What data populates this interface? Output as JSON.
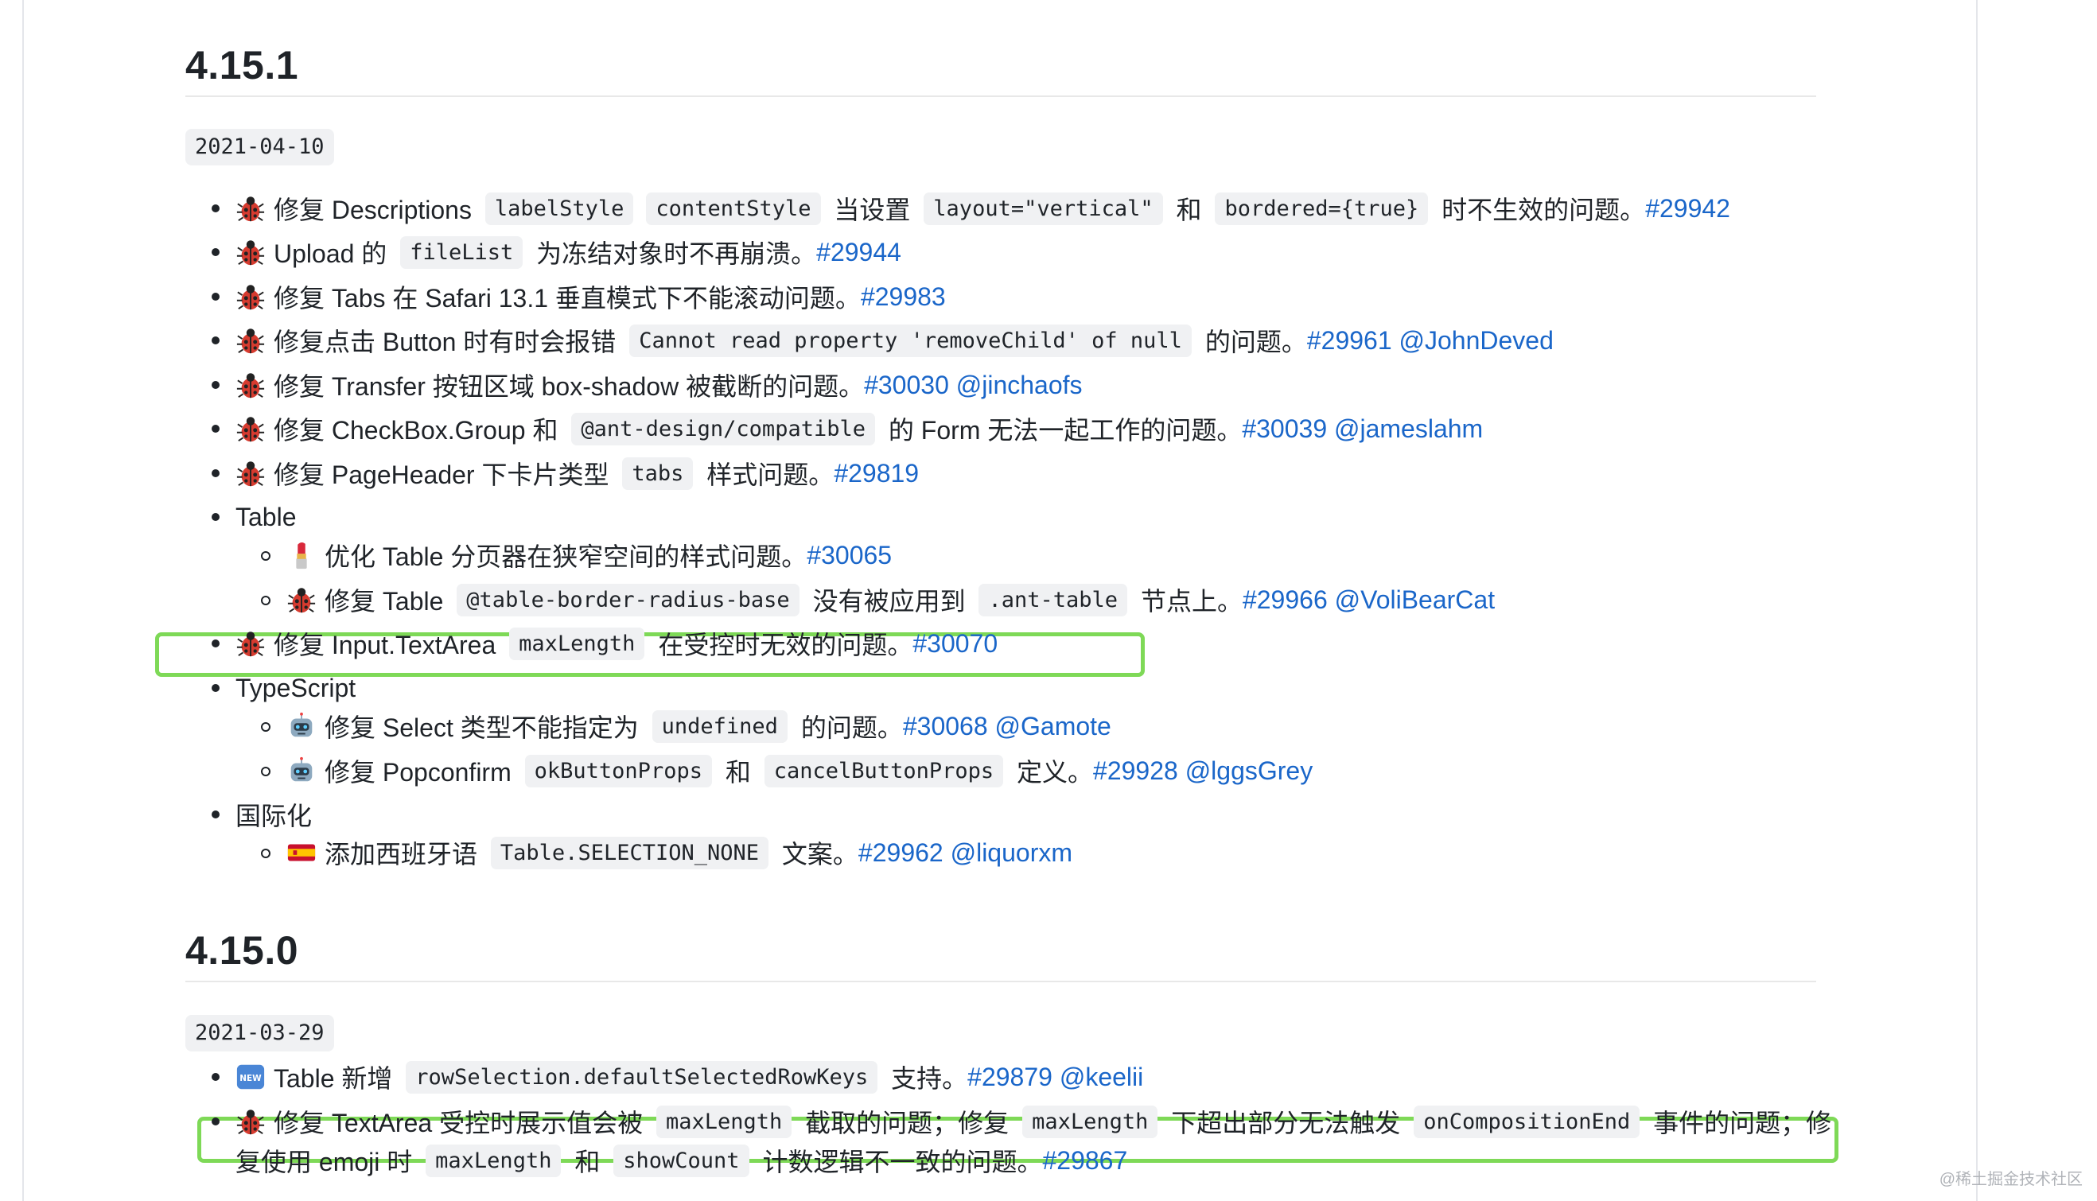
{
  "sections": [
    {
      "version": "4.15.1",
      "date": "2021-04-10",
      "items": [
        {
          "emoji": "bug-icon",
          "parts": [
            {
              "t": "text",
              "v": "修复 Descriptions "
            },
            {
              "t": "code",
              "v": "labelStyle"
            },
            {
              "t": "code",
              "v": "contentStyle"
            },
            {
              "t": "text",
              "v": " 当设置 "
            },
            {
              "t": "code",
              "v": "layout=\"vertical\""
            },
            {
              "t": "text",
              "v": " 和 "
            },
            {
              "t": "code",
              "v": "bordered={true}"
            },
            {
              "t": "text",
              "v": " 时不生效的问题。"
            },
            {
              "t": "link",
              "v": "#29942"
            }
          ]
        },
        {
          "emoji": "bug-icon",
          "parts": [
            {
              "t": "text",
              "v": "Upload 的 "
            },
            {
              "t": "code",
              "v": "fileList"
            },
            {
              "t": "text",
              "v": " 为冻结对象时不再崩溃。"
            },
            {
              "t": "link",
              "v": "#29944"
            }
          ]
        },
        {
          "emoji": "bug-icon",
          "parts": [
            {
              "t": "text",
              "v": "修复 Tabs 在 Safari 13.1 垂直模式下不能滚动问题。"
            },
            {
              "t": "link",
              "v": "#29983"
            }
          ]
        },
        {
          "emoji": "bug-icon",
          "parts": [
            {
              "t": "text",
              "v": "修复点击 Button 时有时会报错 "
            },
            {
              "t": "code",
              "v": "Cannot read property 'removeChild' of null"
            },
            {
              "t": "text",
              "v": " 的问题。"
            },
            {
              "t": "link",
              "v": "#29961"
            },
            {
              "t": "text",
              "v": " "
            },
            {
              "t": "link",
              "v": "@JohnDeved"
            }
          ]
        },
        {
          "emoji": "bug-icon",
          "parts": [
            {
              "t": "text",
              "v": "修复 Transfer 按钮区域 box-shadow 被截断的问题。"
            },
            {
              "t": "link",
              "v": "#30030"
            },
            {
              "t": "text",
              "v": " "
            },
            {
              "t": "link",
              "v": "@jinchaofs"
            }
          ]
        },
        {
          "emoji": "bug-icon",
          "parts": [
            {
              "t": "text",
              "v": "修复 CheckBox.Group 和 "
            },
            {
              "t": "code",
              "v": "@ant-design/compatible"
            },
            {
              "t": "text",
              "v": " 的 Form 无法一起工作的问题。"
            },
            {
              "t": "link",
              "v": "#30039"
            },
            {
              "t": "text",
              "v": " "
            },
            {
              "t": "link",
              "v": "@jameslahm"
            }
          ]
        },
        {
          "emoji": "bug-icon",
          "parts": [
            {
              "t": "text",
              "v": "修复 PageHeader 下卡片类型 "
            },
            {
              "t": "code",
              "v": "tabs"
            },
            {
              "t": "text",
              "v": " 样式问题。"
            },
            {
              "t": "link",
              "v": "#29819"
            }
          ]
        },
        {
          "emoji": "",
          "parts": [
            {
              "t": "text",
              "v": "Table"
            }
          ]
        },
        {
          "emoji": "lipstick-icon",
          "sub": true,
          "parts": [
            {
              "t": "text",
              "v": "优化 Table 分页器在狭窄空间的样式问题。"
            },
            {
              "t": "link",
              "v": "#30065"
            }
          ]
        },
        {
          "emoji": "bug-icon",
          "sub": true,
          "parts": [
            {
              "t": "text",
              "v": "修复 Table "
            },
            {
              "t": "code",
              "v": "@table-border-radius-base"
            },
            {
              "t": "text",
              "v": " 没有被应用到 "
            },
            {
              "t": "code",
              "v": ".ant-table"
            },
            {
              "t": "text",
              "v": " 节点上。"
            },
            {
              "t": "link",
              "v": "#29966"
            },
            {
              "t": "text",
              "v": " "
            },
            {
              "t": "link",
              "v": "@VoliBearCat"
            }
          ]
        },
        {
          "emoji": "bug-icon",
          "parts": [
            {
              "t": "text",
              "v": "修复 Input.TextArea "
            },
            {
              "t": "code",
              "v": "maxLength"
            },
            {
              "t": "text",
              "v": " 在受控时无效的问题。"
            },
            {
              "t": "link",
              "v": "#30070"
            }
          ]
        },
        {
          "emoji": "",
          "parts": [
            {
              "t": "text",
              "v": "TypeScript"
            }
          ]
        },
        {
          "emoji": "robot-icon",
          "sub": true,
          "parts": [
            {
              "t": "text",
              "v": "修复 Select 类型不能指定为 "
            },
            {
              "t": "code",
              "v": "undefined"
            },
            {
              "t": "text",
              "v": " 的问题。"
            },
            {
              "t": "link",
              "v": "#30068"
            },
            {
              "t": "text",
              "v": " "
            },
            {
              "t": "link",
              "v": "@Gamote"
            }
          ]
        },
        {
          "emoji": "robot-icon",
          "sub": true,
          "parts": [
            {
              "t": "text",
              "v": "修复 Popconfirm "
            },
            {
              "t": "code",
              "v": "okButtonProps"
            },
            {
              "t": "text",
              "v": " 和 "
            },
            {
              "t": "code",
              "v": "cancelButtonProps"
            },
            {
              "t": "text",
              "v": " 定义。"
            },
            {
              "t": "link",
              "v": "#29928"
            },
            {
              "t": "text",
              "v": " "
            },
            {
              "t": "link",
              "v": "@lggsGrey"
            }
          ]
        },
        {
          "emoji": "",
          "parts": [
            {
              "t": "text",
              "v": "国际化"
            }
          ]
        },
        {
          "emoji": "spain-flag-icon",
          "sub": true,
          "parts": [
            {
              "t": "text",
              "v": "添加西班牙语 "
            },
            {
              "t": "code",
              "v": "Table.SELECTION_NONE"
            },
            {
              "t": "text",
              "v": " 文案。"
            },
            {
              "t": "link",
              "v": "#29962"
            },
            {
              "t": "text",
              "v": " "
            },
            {
              "t": "link",
              "v": "@liquorxm"
            }
          ]
        }
      ]
    },
    {
      "version": "4.15.0",
      "date": "2021-03-29",
      "items": [
        {
          "emoji": "new-icon",
          "parts": [
            {
              "t": "text",
              "v": "Table 新增 "
            },
            {
              "t": "code",
              "v": "rowSelection.defaultSelectedRowKeys"
            },
            {
              "t": "text",
              "v": " 支持。"
            },
            {
              "t": "link",
              "v": "#29879"
            },
            {
              "t": "text",
              "v": " "
            },
            {
              "t": "link",
              "v": "@keelii"
            }
          ]
        },
        {
          "emoji": "bug-icon",
          "parts": [
            {
              "t": "text",
              "v": "修复 TextArea 受控时展示值会被 "
            },
            {
              "t": "code",
              "v": "maxLength"
            },
            {
              "t": "text",
              "v": " 截取的问题；修复 "
            },
            {
              "t": "code",
              "v": "maxLength"
            },
            {
              "t": "text",
              "v": " 下超出部分无法触发 "
            },
            {
              "t": "code",
              "v": "onCompositionEnd"
            },
            {
              "t": "text",
              "v": " 事件的问题；修"
            }
          ]
        },
        {
          "emoji": "",
          "cont": true,
          "parts": [
            {
              "t": "text",
              "v": "复使用 emoji 时 "
            },
            {
              "t": "code",
              "v": "maxLength"
            },
            {
              "t": "text",
              "v": " 和 "
            },
            {
              "t": "code",
              "v": "showCount"
            },
            {
              "t": "text",
              "v": " 计数逻辑不一致的问题。"
            },
            {
              "t": "link",
              "v": "#29867"
            }
          ]
        }
      ]
    }
  ],
  "highlight_color": "#7ed957",
  "link_color": "#1a66c9",
  "watermark": "@稀土掘金技术社区"
}
